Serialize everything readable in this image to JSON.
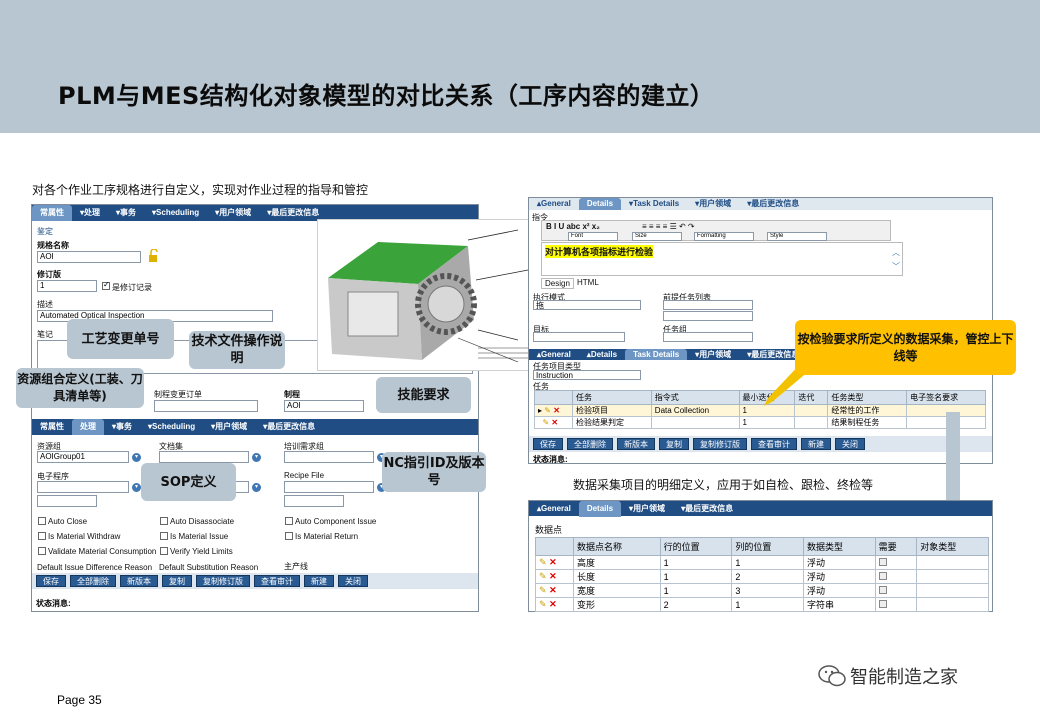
{
  "page": {
    "title": "PLM与MES结构化对象模型的对比关系（工序内容的建立）",
    "left_caption": "对各个作业工序规格进行自定义，实现对作业过程的指导和管控",
    "right_caption": "数据采集项目的明细定义，应用于如自检、跟检、终检等",
    "page_number": "Page 35",
    "brand": "智能制造之家"
  },
  "left_form": {
    "tabs": [
      "常属性",
      "处理",
      "事务",
      "Scheduling",
      "用户领域",
      "最后更改信息"
    ],
    "section": "鉴定",
    "spec_name_label": "规格名称",
    "spec_name_value": "AOI",
    "revision_label": "修订版",
    "revision_value": "1",
    "is_revision_record": "是修订记录",
    "description_label": "描述",
    "description_value": "Automated Optical Inspection",
    "notes_label": "笔记",
    "change_order_label": "制程变更订单",
    "process_label": "制程",
    "process_value": "AOI",
    "tabs2": [
      "常属性",
      "处理",
      "事务",
      "Scheduling",
      "用户领域",
      "最后更改信息"
    ],
    "resource_group_label": "资源组",
    "resource_group_value": "AOIGroup01",
    "document_set_label": "文档集",
    "training_req_label": "培训需求组",
    "e_procedure_label": "电子程序",
    "recipe_file_label": "Recipe File",
    "checkboxes": [
      "Auto Close",
      "Auto Disassociate",
      "Auto Component Issue",
      "Is Material Withdraw",
      "Is Material Issue",
      "Is Material Return",
      "Validate Material Consumption",
      "Verify Yield Limits"
    ],
    "reason_labels": [
      "Default Issue Difference Reason",
      "Default Substitution Reason",
      "主产线"
    ],
    "buttons": [
      "保存",
      "全部删除",
      "新版本",
      "复制",
      "复制修订版",
      "查看审计",
      "新建",
      "关闭"
    ],
    "status_label": "状态消息:"
  },
  "callouts": {
    "process_change": "工艺变更单号",
    "tech_doc": "技术文件操作说明",
    "resource_combo": "资源组合定义(工装、刀具清单等)",
    "skill_req": "技能要求",
    "sop": "SOP定义",
    "nc_program": "NC指引ID及版本号",
    "inspection": "按检验要求所定义的数据采集，管控上下线等"
  },
  "right_top": {
    "tabs": [
      "General",
      "Details",
      "Task Details",
      "用户领域",
      "最后更改信息"
    ],
    "toolbar": {
      "font": "Font",
      "size": "Size",
      "formatting": "Formatting",
      "style": "Style"
    },
    "instruction_label": "指令",
    "editor_text": "对计算机各项指标进行检验",
    "editor_tabs": [
      "Design",
      "HTML"
    ],
    "exec_mode_label": "执行模式",
    "exec_mode_value": "拖",
    "prev_task_label": "前提任务列表",
    "target_label": "目标",
    "task_group_label": "任务组",
    "tabs2": [
      "General",
      "Details",
      "Task Details",
      "用户领域",
      "最后更改信息"
    ],
    "task_item_type_label": "任务项目类型",
    "task_item_type_value": "Instruction",
    "task_label": "任务",
    "columns": [
      "任务",
      "指令式",
      "最小迭代",
      "迭代",
      "任务类型",
      "电子签名要求"
    ],
    "rows": [
      [
        "检验项目",
        "Data Collection",
        "1",
        "",
        "经常性的工作",
        ""
      ],
      [
        "检验结果判定",
        "",
        "1",
        "",
        "结果制程任务",
        ""
      ]
    ],
    "buttons": [
      "保存",
      "全部删除",
      "新版本",
      "复制",
      "复制修订版",
      "查看审计",
      "新建",
      "关闭"
    ],
    "status_label": "状态消息:"
  },
  "right_bottom": {
    "tabs": [
      "General",
      "Details",
      "用户领域",
      "最后更改信息"
    ],
    "section": "数据点",
    "columns": [
      "数据点名称",
      "行的位置",
      "列的位置",
      "数据类型",
      "需要",
      "对象类型"
    ],
    "rows": [
      [
        "高度",
        "1",
        "1",
        "浮动"
      ],
      [
        "长度",
        "1",
        "2",
        "浮动"
      ],
      [
        "宽度",
        "1",
        "3",
        "浮动"
      ],
      [
        "变形",
        "2",
        "1",
        "字符串"
      ]
    ]
  },
  "colors": {
    "header_band": "#b8c6d1",
    "tab_bar": "#1f4d84",
    "callout_yellow": "#ffc000",
    "arrow_yellow": "#f2c200"
  }
}
